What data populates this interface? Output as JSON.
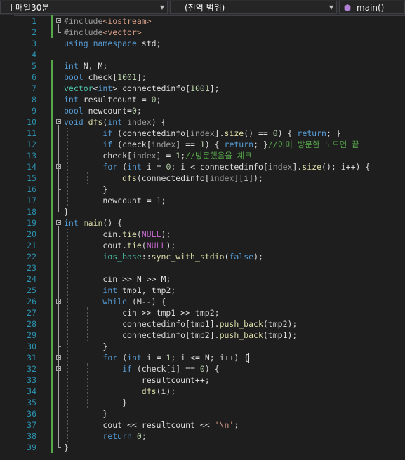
{
  "navbar": {
    "project": "매일30분",
    "scope": "(전역 범위)",
    "member": "main()"
  },
  "lines": [
    {
      "n": "1",
      "s": [
        [
          "pp",
          "#include"
        ],
        [
          "inc",
          "<iostream>"
        ]
      ]
    },
    {
      "n": "2",
      "s": [
        [
          "pp",
          "#include"
        ],
        [
          "inc",
          "<vector>"
        ]
      ]
    },
    {
      "n": "3",
      "s": [
        [
          "kw",
          "using"
        ],
        [
          "",
          " "
        ],
        [
          "kw",
          "namespace"
        ],
        [
          "",
          " std;"
        ]
      ]
    },
    {
      "n": "4",
      "s": []
    },
    {
      "n": "5",
      "s": [
        [
          "kw",
          "int"
        ],
        [
          "",
          " N, M;"
        ]
      ]
    },
    {
      "n": "6",
      "s": [
        [
          "kw",
          "bool"
        ],
        [
          "",
          " check["
        ],
        [
          "num",
          "1001"
        ],
        [
          "",
          "];"
        ]
      ]
    },
    {
      "n": "7",
      "s": [
        [
          "ty",
          "vector"
        ],
        [
          "",
          "<"
        ],
        [
          "kw",
          "int"
        ],
        [
          "",
          "> connectedinfo["
        ],
        [
          "num",
          "1001"
        ],
        [
          "",
          "];"
        ]
      ]
    },
    {
      "n": "8",
      "s": [
        [
          "kw",
          "int"
        ],
        [
          "",
          " resultcount = "
        ],
        [
          "num",
          "0"
        ],
        [
          "",
          ";"
        ]
      ]
    },
    {
      "n": "9",
      "s": [
        [
          "kw",
          "bool"
        ],
        [
          "",
          " newcount="
        ],
        [
          "num",
          "0"
        ],
        [
          "",
          ";"
        ]
      ]
    },
    {
      "n": "10",
      "s": [
        [
          "kw",
          "void"
        ],
        [
          "",
          " "
        ],
        [
          "fn",
          "dfs"
        ],
        [
          "",
          "("
        ],
        [
          "kw",
          "int"
        ],
        [
          "",
          " "
        ],
        [
          "pm",
          "index"
        ],
        [
          "",
          ") {"
        ]
      ]
    },
    {
      "n": "11",
      "s": [
        [
          "",
          "        "
        ],
        [
          "kw",
          "if"
        ],
        [
          "",
          " (connectedinfo["
        ],
        [
          "pm",
          "index"
        ],
        [
          "",
          "]."
        ],
        [
          "fn",
          "size"
        ],
        [
          "",
          "() == "
        ],
        [
          "num",
          "0"
        ],
        [
          "",
          ") { "
        ],
        [
          "kw",
          "return"
        ],
        [
          "",
          "; }"
        ]
      ]
    },
    {
      "n": "12",
      "s": [
        [
          "",
          "        "
        ],
        [
          "kw",
          "if"
        ],
        [
          "",
          " (check["
        ],
        [
          "pm",
          "index"
        ],
        [
          "",
          "] == "
        ],
        [
          "num",
          "1"
        ],
        [
          "",
          ") { "
        ],
        [
          "kw",
          "return"
        ],
        [
          "",
          "; }"
        ],
        [
          "cm",
          "//이미 방문한 노드면 끝"
        ]
      ]
    },
    {
      "n": "13",
      "s": [
        [
          "",
          "        check["
        ],
        [
          "pm",
          "index"
        ],
        [
          "",
          "] = "
        ],
        [
          "num",
          "1"
        ],
        [
          "",
          ";"
        ],
        [
          "cm",
          "//방문했음을 체크"
        ]
      ]
    },
    {
      "n": "14",
      "s": [
        [
          "",
          "        "
        ],
        [
          "kw",
          "for"
        ],
        [
          "",
          " ("
        ],
        [
          "kw",
          "int"
        ],
        [
          "",
          " i = "
        ],
        [
          "num",
          "0"
        ],
        [
          "",
          "; i < connectedinfo["
        ],
        [
          "pm",
          "index"
        ],
        [
          "",
          "]."
        ],
        [
          "fn",
          "size"
        ],
        [
          "",
          "(); i++) {"
        ]
      ]
    },
    {
      "n": "15",
      "s": [
        [
          "",
          "            "
        ],
        [
          "fn",
          "dfs"
        ],
        [
          "",
          "(connectedinfo["
        ],
        [
          "pm",
          "index"
        ],
        [
          "",
          "][i]);"
        ]
      ]
    },
    {
      "n": "16",
      "s": [
        [
          "",
          "        }"
        ]
      ]
    },
    {
      "n": "17",
      "s": [
        [
          "",
          "        newcount = "
        ],
        [
          "num",
          "1"
        ],
        [
          "",
          ";"
        ]
      ]
    },
    {
      "n": "18",
      "s": [
        [
          "",
          "}"
        ]
      ]
    },
    {
      "n": "19",
      "s": [
        [
          "kw",
          "int"
        ],
        [
          "",
          " "
        ],
        [
          "fn",
          "main"
        ],
        [
          "",
          "() {"
        ]
      ]
    },
    {
      "n": "20",
      "s": [
        [
          "",
          "        cin."
        ],
        [
          "fn",
          "tie"
        ],
        [
          "",
          "("
        ],
        [
          "mac",
          "NULL"
        ],
        [
          "",
          ");"
        ]
      ]
    },
    {
      "n": "21",
      "s": [
        [
          "",
          "        cout."
        ],
        [
          "fn",
          "tie"
        ],
        [
          "",
          "("
        ],
        [
          "mac",
          "NULL"
        ],
        [
          "",
          ");"
        ]
      ]
    },
    {
      "n": "22",
      "s": [
        [
          "",
          "        "
        ],
        [
          "ty",
          "ios_base"
        ],
        [
          "",
          "::"
        ],
        [
          "fn",
          "sync_with_stdio"
        ],
        [
          "",
          "("
        ],
        [
          "kw",
          "false"
        ],
        [
          "",
          ");"
        ]
      ]
    },
    {
      "n": "23",
      "s": []
    },
    {
      "n": "24",
      "s": [
        [
          "",
          "        cin >> N >> M;"
        ]
      ]
    },
    {
      "n": "25",
      "s": [
        [
          "",
          "        "
        ],
        [
          "kw",
          "int"
        ],
        [
          "",
          " tmp1, tmp2;"
        ]
      ]
    },
    {
      "n": "26",
      "s": [
        [
          "",
          "        "
        ],
        [
          "kw",
          "while"
        ],
        [
          "",
          " (M--) {"
        ]
      ]
    },
    {
      "n": "27",
      "s": [
        [
          "",
          "            cin >> tmp1 >> tmp2;"
        ]
      ]
    },
    {
      "n": "28",
      "s": [
        [
          "",
          "            connectedinfo[tmp1]."
        ],
        [
          "fn",
          "push_back"
        ],
        [
          "",
          "(tmp2);"
        ]
      ]
    },
    {
      "n": "29",
      "s": [
        [
          "",
          "            connectedinfo[tmp2]."
        ],
        [
          "fn",
          "push_back"
        ],
        [
          "",
          "(tmp1);"
        ]
      ]
    },
    {
      "n": "30",
      "s": [
        [
          "",
          "        }"
        ]
      ]
    },
    {
      "n": "31",
      "s": [
        [
          "",
          "        "
        ],
        [
          "kw",
          "for"
        ],
        [
          "",
          " ("
        ],
        [
          "kw",
          "int"
        ],
        [
          "",
          " i = "
        ],
        [
          "num",
          "1"
        ],
        [
          "",
          "; i <= N; i++) {"
        ]
      ]
    },
    {
      "n": "32",
      "s": [
        [
          "",
          "            "
        ],
        [
          "kw",
          "if"
        ],
        [
          "",
          " (check[i] == "
        ],
        [
          "num",
          "0"
        ],
        [
          "",
          ") {"
        ]
      ]
    },
    {
      "n": "33",
      "s": [
        [
          "",
          "                resultcount++;"
        ]
      ]
    },
    {
      "n": "34",
      "s": [
        [
          "",
          "                "
        ],
        [
          "fn",
          "dfs"
        ],
        [
          "",
          "(i);"
        ]
      ]
    },
    {
      "n": "35",
      "s": [
        [
          "",
          "            }"
        ]
      ]
    },
    {
      "n": "36",
      "s": [
        [
          "",
          "        }"
        ]
      ]
    },
    {
      "n": "37",
      "s": [
        [
          "",
          "        cout << resultcount << "
        ],
        [
          "str",
          "'\\n'"
        ],
        [
          "",
          ";"
        ]
      ]
    },
    {
      "n": "38",
      "s": [
        [
          "",
          "        "
        ],
        [
          "kw",
          "return"
        ],
        [
          "",
          " "
        ],
        [
          "num",
          "0"
        ],
        [
          "",
          ";"
        ]
      ]
    },
    {
      "n": "39",
      "s": [
        [
          "",
          "}"
        ]
      ]
    }
  ]
}
